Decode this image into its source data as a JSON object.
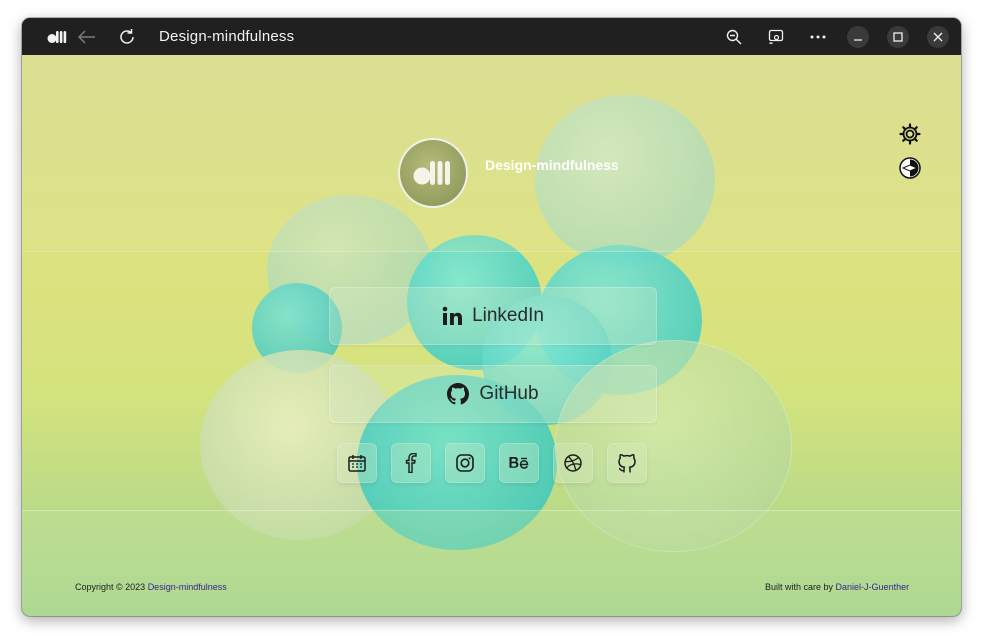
{
  "window": {
    "title": "Design-mindfulness"
  },
  "profile": {
    "name": "Design-mindfulness",
    "avatar_icon": "dll-logo-icon"
  },
  "links": [
    {
      "label": "LinkedIn",
      "icon": "linkedin-icon"
    },
    {
      "label": "GitHub",
      "icon": "github-icon"
    }
  ],
  "social_icons": [
    "calendar-icon",
    "facebook-icon",
    "instagram-icon",
    "behance-icon",
    "dribbble-icon",
    "github-icon"
  ],
  "footer": {
    "copyright": "Copyright © 2023",
    "copyright_link": "Design-mindfulness",
    "built_with": "Built with care by",
    "author_link": "Daniel-J-Guenther"
  },
  "colors": {
    "titlebar": "#202020",
    "link_accent": "#3a1f8a",
    "text_dark": "#2b2b2b"
  }
}
